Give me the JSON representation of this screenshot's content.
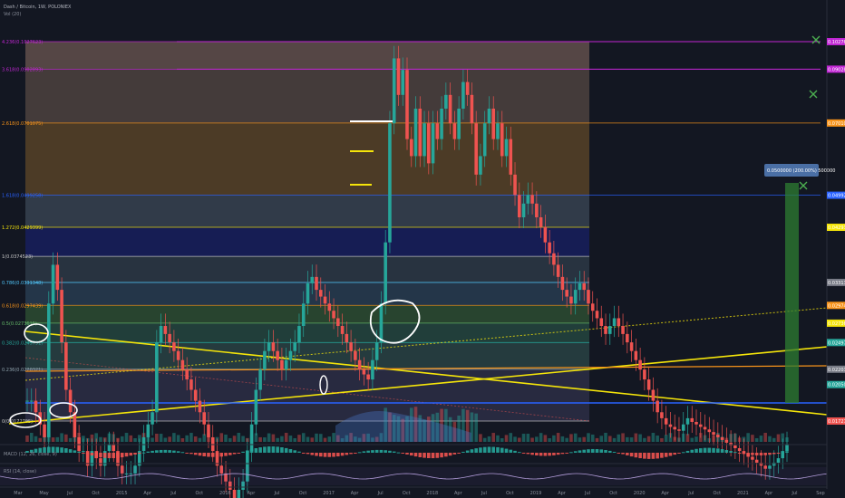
{
  "header": {
    "symbol_line": "Dash / Bitcoin, 1W, POLONIEX",
    "indicator_line": "Vol (20)"
  },
  "panes": {
    "macd_label": "MACD (12, 26, close, 9)",
    "rsi_label": "RSI (14, close)"
  },
  "colors": {
    "background": "#131722",
    "up_candle": "#26a69a",
    "down_candle": "#ef5350",
    "trendline": "#f5e50a",
    "fib_orange": "#f7931a",
    "magenta": "#c026d3",
    "blue_level": "#2962ff",
    "green_box": "#2e7d32",
    "white_mark": "#ffffff"
  },
  "fib_levels": [
    {
      "label": "4.236(0.1027623)",
      "price": 0.1027623,
      "color": "#c026d3"
    },
    {
      "label": "3.618(0.0902893)",
      "price": 0.0902893,
      "color": "#c026d3"
    },
    {
      "label": "2.618(0.0701075)",
      "price": 0.0701075,
      "color": "#f7931a"
    },
    {
      "label": "1.618(0.0499258)",
      "price": 0.0499258,
      "color": "#2962ff"
    },
    {
      "label": "1.272(0.0429399)",
      "price": 0.0429399,
      "color": "#f5e50a"
    },
    {
      "label": "1(0.0374523)",
      "price": 0.0374523,
      "color": "#c8c8c8"
    },
    {
      "label": "0.786(0.0331348)",
      "price": 0.0331348,
      "color": "#4fc3f7"
    },
    {
      "label": "0.618(0.0297439)",
      "price": 0.0297439,
      "color": "#f7931a"
    },
    {
      "label": "0.5(0.0273615)",
      "price": 0.0273615,
      "color": "#66bb6a"
    },
    {
      "label": "0.382(0.0249791)",
      "price": 0.0249791,
      "color": "#26a69a"
    },
    {
      "label": "0.236(0.0220321)",
      "price": 0.0220321,
      "color": "#90a4ae"
    },
    {
      "label": "0(0.0172705)",
      "price": 0.0172705,
      "color": "#c8c8c8"
    }
  ],
  "price_tags": [
    {
      "text": "0.1027623",
      "color": "#c026d3"
    },
    {
      "text": "0.0902893",
      "color": "#c026d3"
    },
    {
      "text": "0.0701075",
      "color": "#f7931a"
    },
    {
      "text": "0.0499258",
      "color": "#2962ff"
    },
    {
      "text": "0.0429399",
      "color": "#f5e50a"
    },
    {
      "text": "0.0331348",
      "color": "#787b86"
    },
    {
      "text": "0.0297439",
      "color": "#f7931a"
    },
    {
      "text": "0.0273615",
      "color": "#f5e50a"
    },
    {
      "text": "0.0249791",
      "color": "#26a69a"
    },
    {
      "text": "0.0220321",
      "color": "#787b86"
    },
    {
      "text": "0.0205000",
      "color": "#26a69a"
    },
    {
      "text": "0.0172705",
      "color": "#ef5350"
    }
  ],
  "projection_label": "0.0500000 (200.00%) 500000",
  "time_axis": [
    "Mar",
    "May",
    "Jul",
    "Oct",
    "2015",
    "Apr",
    "Jul",
    "Oct",
    "2016",
    "Apr",
    "Jul",
    "Oct",
    "2017",
    "Apr",
    "Jul",
    "Oct",
    "2018",
    "Apr",
    "Jul",
    "Oct",
    "2019",
    "Apr",
    "Jul",
    "Oct",
    "2020",
    "Apr",
    "Jul",
    "Oct",
    "2021",
    "Apr",
    "Jul",
    "Sep"
  ],
  "chart_data": {
    "type": "candlestick",
    "title": "Dash / Bitcoin, 1W, POLONIEX",
    "scale": "log",
    "ylim": [
      0.008,
      0.13
    ],
    "series": [
      {
        "name": "DASHBTC",
        "values": [
          0.019,
          0.019,
          0.018,
          0.017,
          0.016,
          0.03,
          0.036,
          0.032,
          0.025,
          0.02,
          0.018,
          0.016,
          0.015,
          0.015,
          0.014,
          0.015,
          0.0145,
          0.014,
          0.015,
          0.0155,
          0.015,
          0.014,
          0.0135,
          0.0135,
          0.0135,
          0.014,
          0.015,
          0.016,
          0.017,
          0.018,
          0.025,
          0.027,
          0.026,
          0.025,
          0.024,
          0.023,
          0.022,
          0.021,
          0.02,
          0.019,
          0.018,
          0.017,
          0.016,
          0.015,
          0.014,
          0.0135,
          0.013,
          0.0125,
          0.012,
          0.0125,
          0.013,
          0.015,
          0.017,
          0.02,
          0.022,
          0.024,
          0.025,
          0.024,
          0.023,
          0.022,
          0.023,
          0.024,
          0.025,
          0.027,
          0.03,
          0.033,
          0.034,
          0.032,
          0.031,
          0.03,
          0.029,
          0.028,
          0.027,
          0.026,
          0.025,
          0.024,
          0.023,
          0.022,
          0.0215,
          0.021,
          0.023,
          0.025,
          0.03,
          0.04,
          0.07,
          0.095,
          0.08,
          0.09,
          0.065,
          0.06,
          0.075,
          0.06,
          0.07,
          0.058,
          0.07,
          0.065,
          0.075,
          0.08,
          0.07,
          0.065,
          0.075,
          0.085,
          0.08,
          0.07,
          0.055,
          0.06,
          0.07,
          0.075,
          0.065,
          0.07,
          0.06,
          0.065,
          0.055,
          0.05,
          0.045,
          0.048,
          0.05,
          0.048,
          0.045,
          0.043,
          0.04,
          0.038,
          0.036,
          0.034,
          0.032,
          0.031,
          0.03,
          0.032,
          0.033,
          0.032,
          0.03,
          0.029,
          0.028,
          0.027,
          0.026,
          0.027,
          0.028,
          0.027,
          0.026,
          0.025,
          0.024,
          0.023,
          0.022,
          0.021,
          0.02,
          0.019,
          0.018,
          0.0175,
          0.017,
          0.0168,
          0.0166,
          0.0165,
          0.017,
          0.0175,
          0.0172,
          0.017,
          0.0168,
          0.0166,
          0.0164,
          0.0162,
          0.016,
          0.0158,
          0.0156,
          0.0154,
          0.0152,
          0.015,
          0.0148,
          0.0146,
          0.0144,
          0.0142,
          0.014,
          0.0138,
          0.014,
          0.0142,
          0.0145,
          0.015,
          0.0155
        ]
      }
    ],
    "annotations": [
      "Fib extension 0 – 4.236",
      "projection box 200.00%"
    ]
  }
}
